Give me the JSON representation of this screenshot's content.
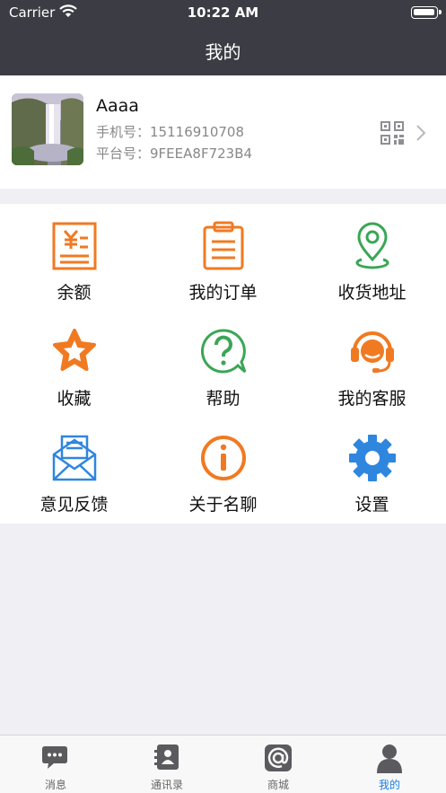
{
  "status_bar": {
    "carrier": "Carrier",
    "time": "10:22 AM"
  },
  "nav": {
    "title": "我的"
  },
  "profile": {
    "name": "Aaaa",
    "phone_label": "手机号：",
    "phone": "15116910708",
    "platform_label": "平台号：",
    "platform_id": "9FEEA8F723B4"
  },
  "menu": [
    {
      "label": "余额",
      "icon": "balance-icon",
      "color": "#f07a22"
    },
    {
      "label": "我的订单",
      "icon": "clipboard-icon",
      "color": "#f07a22"
    },
    {
      "label": "收货地址",
      "icon": "location-pin-icon",
      "color": "#3aa655"
    },
    {
      "label": "收藏",
      "icon": "star-icon",
      "color": "#f07a22"
    },
    {
      "label": "帮助",
      "icon": "help-icon",
      "color": "#3aa655"
    },
    {
      "label": "我的客服",
      "icon": "headset-icon",
      "color": "#f07a22"
    },
    {
      "label": "意见反馈",
      "icon": "envelope-icon",
      "color": "#2f86de"
    },
    {
      "label": "关于名聊",
      "icon": "info-icon",
      "color": "#f07a22"
    },
    {
      "label": "设置",
      "icon": "gear-icon",
      "color": "#2f86de"
    }
  ],
  "tabs": [
    {
      "label": "消息",
      "icon": "chat-icon"
    },
    {
      "label": "通讯录",
      "icon": "contacts-icon"
    },
    {
      "label": "商城",
      "icon": "at-sign-icon"
    },
    {
      "label": "我的",
      "icon": "person-icon",
      "active": true
    }
  ],
  "colors": {
    "header": "#3c3c44",
    "tab_active": "#1a7de0",
    "tab_inactive": "#666666"
  }
}
